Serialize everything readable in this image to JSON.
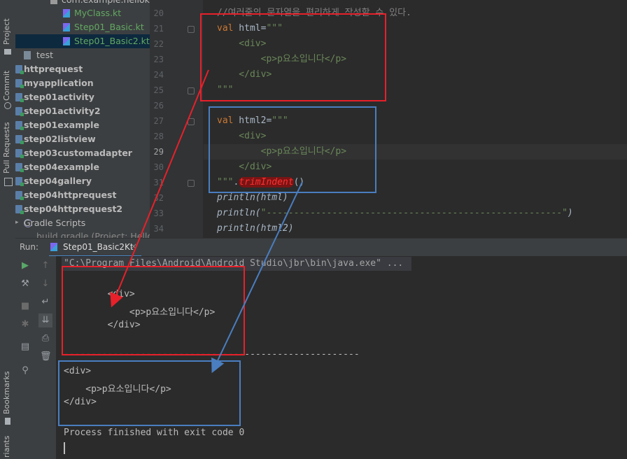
{
  "left_strip": {
    "tabs": [
      "Project",
      "Commit",
      "Pull Requests",
      "Bookmarks",
      "riants"
    ]
  },
  "project_tree": {
    "top_partial": "com.example.hellokotl",
    "files": [
      {
        "label": "MyClass.kt",
        "color": "#5fae5f"
      },
      {
        "label": "Step01_Basic.kt",
        "color": "#5fae5f"
      },
      {
        "label": "Step01_Basic2.kt",
        "color": "#5fae5f"
      }
    ],
    "test_folder": "test",
    "modules": [
      "httprequest",
      "myapplication",
      "step01activity",
      "step01activity2",
      "step01example",
      "step02listview",
      "step03customadapter",
      "step04example",
      "step04gallery",
      "step04httprequest",
      "step04httprequest2"
    ],
    "gradle": "Gradle Scripts",
    "bottom_partial": "build.gradle (Project: Hello"
  },
  "editor": {
    "line_numbers": [
      "20",
      "21",
      "22",
      "23",
      "24",
      "25",
      "26",
      "27",
      "28",
      "29",
      "30",
      "31",
      "32",
      "33",
      "34"
    ],
    "lines": {
      "l20": "//여러줄의 문자열을 편리하게 작성할 수 있다.",
      "l21_kw": "val",
      "l21_rest": " html=",
      "l21_str": "\"\"\"",
      "l22": "    <div>",
      "l23": "        <p>p요소입니다</p>",
      "l24": "    </div>",
      "l25": "\"\"\"",
      "l27_kw": "val",
      "l27_rest": " html2=",
      "l27_str": "\"\"\"",
      "l28": "    <div>",
      "l29": "        <p>p요소입니다</p>",
      "l30": "    </div>",
      "l31_str": "\"\"\"",
      "l31_dot": ".",
      "l31_fn": "trimIndent",
      "l31_paren": "()",
      "l32": "println(html)",
      "l33_a": "println(",
      "l33_str": "\"------------------------------------------------------\"",
      "l33_b": ")",
      "l34": "println(html2)"
    }
  },
  "run_panel": {
    "label": "Run:",
    "tab": "Step01_Basic2Kt",
    "close": "×"
  },
  "console": {
    "command": "\"C:\\Program Files\\Android\\Android Studio\\jbr\\bin\\java.exe\" ...",
    "out1_open": "        <div>",
    "out1_p": "            <p>p요소입니다</p>",
    "out1_close": "        </div>",
    "separator": "------------------------------------------------------",
    "out2_open": "<div>",
    "out2_p": "    <p>p요소입니다</p>",
    "out2_close": "</div>",
    "finish": "Process finished with exit code 0"
  },
  "colors": {
    "red_annotation": "#e8202a",
    "blue_annotation": "#4a7ec0"
  }
}
